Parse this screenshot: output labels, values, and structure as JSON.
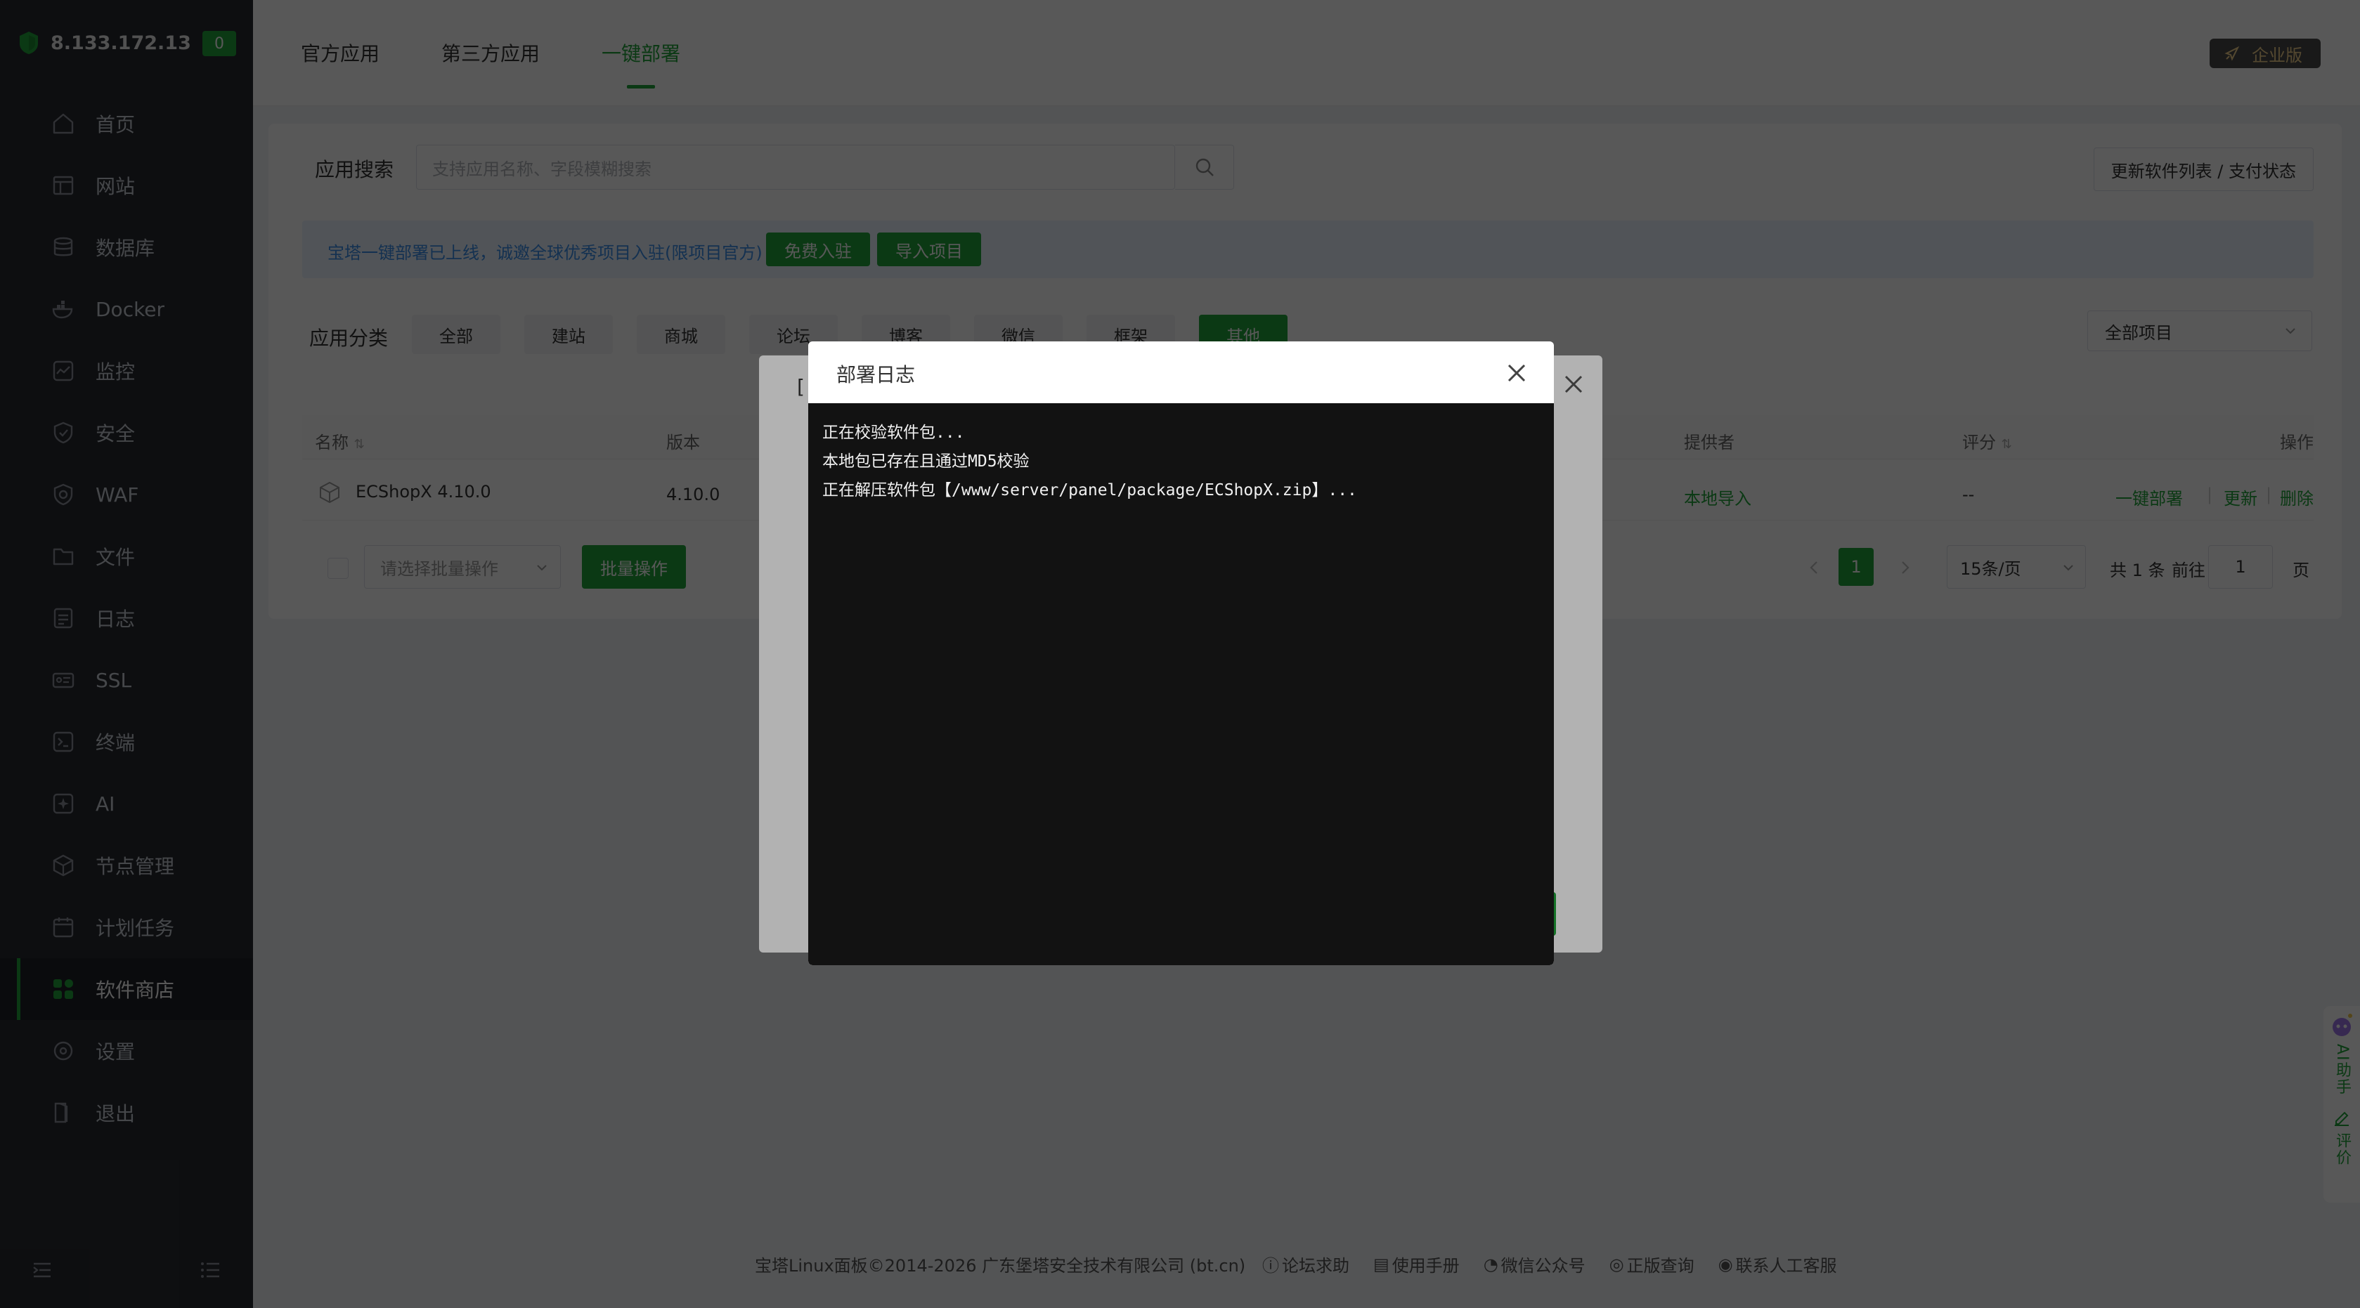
{
  "sidebar": {
    "ip": "8.133.172.13",
    "badge": "0",
    "items": [
      {
        "label": "首页",
        "icon": "home-icon"
      },
      {
        "label": "网站",
        "icon": "website-icon"
      },
      {
        "label": "数据库",
        "icon": "database-icon"
      },
      {
        "label": "Docker",
        "icon": "docker-icon"
      },
      {
        "label": "监控",
        "icon": "monitor-icon"
      },
      {
        "label": "安全",
        "icon": "shield-icon"
      },
      {
        "label": "WAF",
        "icon": "waf-icon"
      },
      {
        "label": "文件",
        "icon": "folder-icon"
      },
      {
        "label": "日志",
        "icon": "log-icon"
      },
      {
        "label": "SSL",
        "icon": "ssl-icon"
      },
      {
        "label": "终端",
        "icon": "terminal-icon"
      },
      {
        "label": "AI",
        "icon": "ai-icon"
      },
      {
        "label": "节点管理",
        "icon": "node-icon"
      },
      {
        "label": "计划任务",
        "icon": "calendar-icon"
      },
      {
        "label": "软件商店",
        "icon": "appstore-icon",
        "active": true
      },
      {
        "label": "设置",
        "icon": "settings-icon"
      },
      {
        "label": "退出",
        "icon": "logout-icon"
      }
    ]
  },
  "topbar": {
    "tabs": [
      "官方应用",
      "第三方应用",
      "一键部署"
    ],
    "active_tab": "一键部署",
    "enterprise": "企业版"
  },
  "search": {
    "label": "应用搜索",
    "placeholder": "支持应用名称、字段模糊搜索",
    "update_button": "更新软件列表 / 支付状态"
  },
  "notice": {
    "text": "宝塔一键部署已上线，诚邀全球优秀项目入驻(限项目官方)",
    "join_button": "免费入驻",
    "import_button": "导入项目"
  },
  "categories": {
    "label": "应用分类",
    "items": [
      "全部",
      "建站",
      "商城",
      "论坛",
      "博客",
      "微信",
      "框架",
      "其他"
    ],
    "active": "其他",
    "filter": "全部项目"
  },
  "table": {
    "headers": {
      "name": "名称",
      "version": "版本",
      "provider": "提供者",
      "rating": "评分",
      "actions": "操作"
    },
    "rows": [
      {
        "name": "ECShopX 4.10.0",
        "version": "4.10.0",
        "provider": "本地导入",
        "rating": "--",
        "actions": [
          "一键部署",
          "更新",
          "删除"
        ]
      }
    ]
  },
  "batch": {
    "placeholder": "请选择批量操作",
    "button": "批量操作"
  },
  "pagination": {
    "current_page": "1",
    "per_page": "15条/页",
    "total": "共 1 条",
    "goto_label": "前往",
    "goto_value": "1",
    "page_suffix": "页"
  },
  "footer": {
    "copyright": "宝塔Linux面板©2014-2026 广东堡塔安全技术有限公司 (bt.cn)",
    "links": [
      "论坛求助",
      "使用手册",
      "微信公众号",
      "正版查询",
      "联系人工客服"
    ]
  },
  "ai_helper": {
    "label": "AI助手",
    "feedback": "评价"
  },
  "back_dialog": {
    "bracket": "["
  },
  "log_dialog": {
    "title": "部署日志",
    "lines": [
      "正在校验软件包...",
      "本地包已存在且通过MD5校验",
      "正在解压软件包【/www/server/panel/package/ECShopX.zip】..."
    ]
  },
  "colors": {
    "accent": "#20a53a",
    "sidebar_bg": "#272a31",
    "terminal_bg": "#121212",
    "notice_text": "#3b8ee8"
  }
}
